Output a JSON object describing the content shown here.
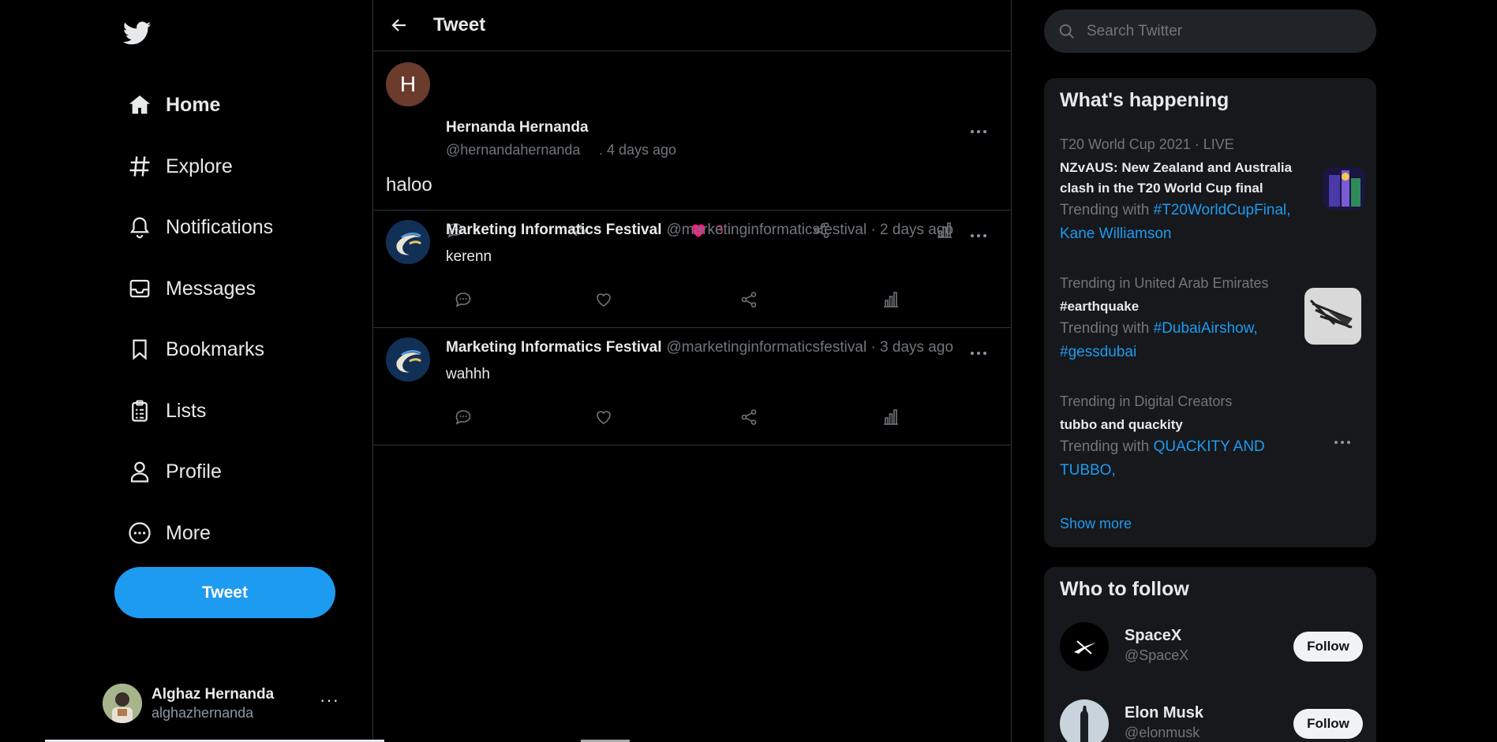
{
  "nav": {
    "items": [
      {
        "label": "Home",
        "icon": "home-icon"
      },
      {
        "label": "Explore",
        "icon": "hashtag-icon"
      },
      {
        "label": "Notifications",
        "icon": "bell-icon"
      },
      {
        "label": "Messages",
        "icon": "envelope-icon"
      },
      {
        "label": "Bookmarks",
        "icon": "bookmark-icon"
      },
      {
        "label": "Lists",
        "icon": "list-icon"
      },
      {
        "label": "Profile",
        "icon": "person-icon"
      },
      {
        "label": "More",
        "icon": "more-circle-icon"
      }
    ],
    "tweet_button": "Tweet"
  },
  "account": {
    "name": "Alghaz Hernanda",
    "handle": "alghazhernanda",
    "more": "···"
  },
  "main": {
    "title": "Tweet",
    "tweet": {
      "avatar_letter": "H",
      "name": "Hernanda Hernanda",
      "handle": "@hernandahernanda",
      "time": ". 4 days ago",
      "text": "haloo",
      "reply_count": "2",
      "like_count": "3"
    },
    "replies": [
      {
        "name": "Marketing Informatics Festival",
        "meta": "@marketinginformaticsfestival · 2 days ago",
        "text": "kerenn"
      },
      {
        "name": "Marketing Informatics Festival",
        "meta": "@marketinginformaticsfestival · 3 days ago",
        "text": "wahhh"
      }
    ]
  },
  "search": {
    "placeholder": "Search Twitter"
  },
  "trends": {
    "title": "What's happening",
    "items": [
      {
        "context": "T20 World Cup 2021 · LIVE",
        "title": "NZvAUS: New Zealand and Australia clash in the T20 World Cup final",
        "with_label": "Trending with ",
        "with_links": "#T20WorldCupFinal, Kane Williamson"
      },
      {
        "context": "Trending in United Arab Emirates",
        "title": "#earthquake",
        "with_label": "Trending with ",
        "with_links": "#DubaiAirshow, #gessdubai"
      },
      {
        "context": "Trending in Digital Creators",
        "title": "tubbo and quackity",
        "with_label": "Trending with ",
        "with_links": "QUACKITY AND TUBBO,"
      }
    ],
    "show_more": "Show more"
  },
  "follow": {
    "title": "Who to follow",
    "items": [
      {
        "name": "SpaceX",
        "handle": "@SpaceX",
        "button": "Follow"
      },
      {
        "name": "Elon Musk",
        "handle": "@elonmusk",
        "button": "Follow"
      }
    ]
  },
  "colors": {
    "accent": "#1d9bf0",
    "like": "#f91880",
    "background": "#000000",
    "panel": "#16181c"
  }
}
